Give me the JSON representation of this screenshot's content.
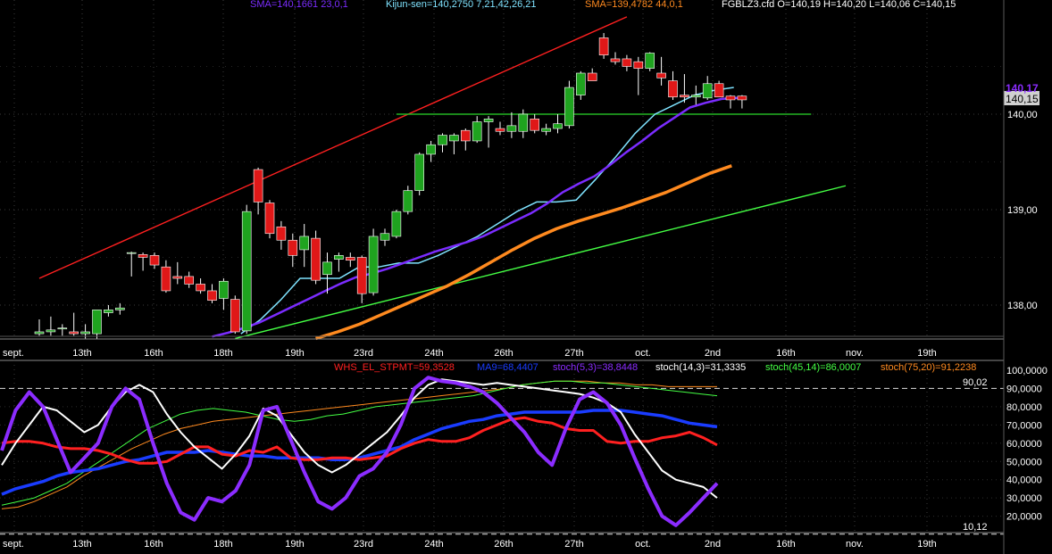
{
  "price_panel": {
    "legend": [
      {
        "text": "SMA=140,1661  23,0,1",
        "color": "#7b2cff"
      },
      {
        "text": "Kijun-sen=140,2750  7,21,42,26,21",
        "color": "#7fe3ff"
      },
      {
        "text": "SMA=139,4782  44,0,1",
        "color": "#ff8a1f"
      },
      {
        "text": "FGBLZ3.cfd O=140,19 H=140,20 L=140,06 C=140,15",
        "color": "#ffffff"
      }
    ],
    "last_price_label": "140,15",
    "high_price_label": "140,17",
    "y_ticks": [
      "140,00",
      "139,00",
      "138,00"
    ]
  },
  "oscillator_panel": {
    "legend": [
      {
        "text": "WHS_EL_STPMT=59,3528",
        "color": "#ff2020"
      },
      {
        "text": "MA9=68,4407",
        "color": "#1a3cff"
      },
      {
        "text": "stoch(5,3)=38,8448",
        "color": "#8b2cff"
      },
      {
        "text": "stoch(14,3)=31,3335",
        "color": "#ffffff"
      },
      {
        "text": "stoch(45,14)=86,0007",
        "color": "#44ff44"
      },
      {
        "text": "stoch(75,20)=91,2238",
        "color": "#ff8a1f"
      }
    ],
    "upper_level_label": "90,02",
    "lower_level_label": "10,12",
    "y_ticks": [
      "100,0000",
      "90,0000",
      "80,0000",
      "70,0000",
      "60,0000",
      "50,0000",
      "40,0000",
      "30,0000",
      "20,0000"
    ]
  },
  "x_axis_labels": [
    "sept.",
    "13th",
    "16th",
    "18th",
    "19th",
    "23rd",
    "24th",
    "26th",
    "27th",
    "oct.",
    "2nd",
    "16th",
    "nov.",
    "19th"
  ],
  "chart_data": [
    {
      "type": "candlestick",
      "instrument": "FGBLZ3.cfd",
      "ylim": [
        137.65,
        141.2
      ],
      "candles": [
        {
          "o": 137.7,
          "h": 137.85,
          "l": 137.68,
          "c": 137.72
        },
        {
          "o": 137.72,
          "h": 137.88,
          "l": 137.68,
          "c": 137.74
        },
        {
          "o": 137.75,
          "h": 137.8,
          "l": 137.68,
          "c": 137.76
        },
        {
          "o": 137.72,
          "h": 137.92,
          "l": 137.68,
          "c": 137.7
        },
        {
          "o": 137.7,
          "h": 137.8,
          "l": 137.65,
          "c": 137.72
        },
        {
          "o": 137.7,
          "h": 137.9,
          "l": 137.65,
          "c": 137.95
        },
        {
          "o": 137.92,
          "h": 138.0,
          "l": 137.88,
          "c": 137.95
        },
        {
          "o": 137.95,
          "h": 138.02,
          "l": 137.9,
          "c": 137.97
        },
        {
          "o": 138.54,
          "h": 138.56,
          "l": 138.3,
          "c": 138.55
        },
        {
          "o": 138.53,
          "h": 138.55,
          "l": 138.36,
          "c": 138.5
        },
        {
          "o": 138.52,
          "h": 138.55,
          "l": 138.38,
          "c": 138.42
        },
        {
          "o": 138.4,
          "h": 138.47,
          "l": 138.13,
          "c": 138.15
        },
        {
          "o": 138.3,
          "h": 138.45,
          "l": 138.22,
          "c": 138.28
        },
        {
          "o": 138.3,
          "h": 138.35,
          "l": 138.18,
          "c": 138.22
        },
        {
          "o": 138.22,
          "h": 138.28,
          "l": 138.12,
          "c": 138.15
        },
        {
          "o": 138.15,
          "h": 138.22,
          "l": 138.02,
          "c": 138.05
        },
        {
          "o": 138.07,
          "h": 138.28,
          "l": 137.95,
          "c": 138.25
        },
        {
          "o": 138.06,
          "h": 138.1,
          "l": 137.7,
          "c": 137.72
        },
        {
          "o": 137.73,
          "h": 139.05,
          "l": 137.7,
          "c": 138.98
        },
        {
          "o": 139.42,
          "h": 139.44,
          "l": 138.95,
          "c": 139.08
        },
        {
          "o": 139.07,
          "h": 139.1,
          "l": 138.7,
          "c": 138.75
        },
        {
          "o": 138.82,
          "h": 138.88,
          "l": 138.58,
          "c": 138.68
        },
        {
          "o": 138.68,
          "h": 138.75,
          "l": 138.4,
          "c": 138.52
        },
        {
          "o": 138.58,
          "h": 138.85,
          "l": 138.4,
          "c": 138.72
        },
        {
          "o": 138.7,
          "h": 138.78,
          "l": 138.22,
          "c": 138.26
        },
        {
          "o": 138.32,
          "h": 138.55,
          "l": 138.12,
          "c": 138.45
        },
        {
          "o": 138.48,
          "h": 138.55,
          "l": 138.35,
          "c": 138.52
        },
        {
          "o": 138.5,
          "h": 138.55,
          "l": 138.4,
          "c": 138.47
        },
        {
          "o": 138.5,
          "h": 138.52,
          "l": 138.02,
          "c": 138.12
        },
        {
          "o": 138.13,
          "h": 138.8,
          "l": 138.1,
          "c": 138.72
        },
        {
          "o": 138.68,
          "h": 138.8,
          "l": 138.62,
          "c": 138.75
        },
        {
          "o": 138.72,
          "h": 139.0,
          "l": 138.7,
          "c": 138.98
        },
        {
          "o": 138.98,
          "h": 139.25,
          "l": 138.95,
          "c": 139.2
        },
        {
          "o": 139.2,
          "h": 139.6,
          "l": 139.15,
          "c": 139.58
        },
        {
          "o": 139.58,
          "h": 139.72,
          "l": 139.5,
          "c": 139.68
        },
        {
          "o": 139.68,
          "h": 139.8,
          "l": 139.6,
          "c": 139.78
        },
        {
          "o": 139.72,
          "h": 139.8,
          "l": 139.58,
          "c": 139.78
        },
        {
          "o": 139.83,
          "h": 139.85,
          "l": 139.62,
          "c": 139.72
        },
        {
          "o": 139.72,
          "h": 139.98,
          "l": 139.7,
          "c": 139.92
        },
        {
          "o": 139.92,
          "h": 139.98,
          "l": 139.65,
          "c": 139.95
        },
        {
          "o": 139.85,
          "h": 139.92,
          "l": 139.78,
          "c": 139.82
        },
        {
          "o": 139.82,
          "h": 140.02,
          "l": 139.75,
          "c": 139.88
        },
        {
          "o": 139.82,
          "h": 140.05,
          "l": 139.75,
          "c": 140.0
        },
        {
          "o": 139.95,
          "h": 140.0,
          "l": 139.8,
          "c": 139.83
        },
        {
          "o": 139.82,
          "h": 139.9,
          "l": 139.78,
          "c": 139.85
        },
        {
          "o": 139.85,
          "h": 140.0,
          "l": 139.8,
          "c": 139.9
        },
        {
          "o": 139.88,
          "h": 140.35,
          "l": 139.85,
          "c": 140.28
        },
        {
          "o": 140.2,
          "h": 140.45,
          "l": 140.15,
          "c": 140.43
        },
        {
          "o": 140.43,
          "h": 140.48,
          "l": 140.38,
          "c": 140.35
        },
        {
          "o": 140.8,
          "h": 140.85,
          "l": 140.58,
          "c": 140.62
        },
        {
          "o": 140.58,
          "h": 140.65,
          "l": 140.52,
          "c": 140.55
        },
        {
          "o": 140.58,
          "h": 140.62,
          "l": 140.45,
          "c": 140.5
        },
        {
          "o": 140.55,
          "h": 140.6,
          "l": 140.2,
          "c": 140.48
        },
        {
          "o": 140.48,
          "h": 140.65,
          "l": 140.45,
          "c": 140.64
        },
        {
          "o": 140.43,
          "h": 140.6,
          "l": 140.3,
          "c": 140.38
        },
        {
          "o": 140.35,
          "h": 140.45,
          "l": 140.15,
          "c": 140.18
        },
        {
          "o": 140.2,
          "h": 140.42,
          "l": 140.12,
          "c": 140.18
        },
        {
          "o": 140.18,
          "h": 140.3,
          "l": 140.1,
          "c": 140.2
        },
        {
          "o": 140.17,
          "h": 140.4,
          "l": 140.15,
          "c": 140.32
        },
        {
          "o": 140.32,
          "h": 140.35,
          "l": 140.18,
          "c": 140.18
        },
        {
          "o": 140.19,
          "h": 140.2,
          "l": 140.06,
          "c": 140.15
        },
        {
          "o": 140.19,
          "h": 140.2,
          "l": 140.06,
          "c": 140.15
        }
      ],
      "sma_23": [
        137.67,
        137.71,
        137.76,
        137.82,
        137.9,
        137.98,
        138.06,
        138.14,
        138.22,
        138.29,
        138.33,
        138.38,
        138.44,
        138.5,
        138.56,
        138.61,
        138.66,
        138.72,
        138.8,
        138.88,
        138.96,
        139.06,
        139.18,
        139.27,
        139.35,
        139.47,
        139.6,
        139.72,
        139.85,
        139.96,
        140.07,
        140.12,
        140.16,
        140.17
      ],
      "kijun_sen": [
        137.7,
        137.85,
        138.05,
        138.28,
        138.28,
        138.28,
        138.4,
        138.4,
        138.44,
        138.44,
        138.52,
        138.62,
        138.72,
        138.85,
        138.98,
        139.08,
        139.08,
        139.1,
        139.32,
        139.55,
        139.8,
        140.0,
        140.1,
        140.2,
        140.25,
        140.28
      ],
      "sma_44": [
        137.65,
        137.72,
        137.8,
        137.9,
        138.0,
        138.1,
        138.2,
        138.32,
        138.45,
        138.58,
        138.7,
        138.8,
        138.88,
        138.95,
        139.02,
        139.1,
        139.18,
        139.28,
        139.38,
        139.46
      ],
      "reference_lines": [
        {
          "name": "upper channel",
          "from": [
            0,
            138.28
          ],
          "to": [
            51,
            141.02
          ],
          "color": "#ff2020"
        },
        {
          "name": "horizontal level",
          "from": [
            31,
            140.0
          ],
          "to": [
            67,
            140.0
          ],
          "color": "#22b522"
        },
        {
          "name": "lower trendline",
          "from": [
            17,
            137.65
          ],
          "to": [
            70,
            139.25
          ],
          "color": "#44ff44"
        }
      ]
    },
    {
      "type": "line",
      "ylim": [
        10,
        102
      ],
      "levels": [
        90.02,
        10.12
      ],
      "series": [
        {
          "name": "WHS_EL_STPMT",
          "values": [
            60,
            61,
            61,
            60,
            58,
            57,
            57,
            56,
            54,
            51,
            49,
            49,
            50,
            54,
            58,
            58,
            54,
            53,
            56,
            55,
            58,
            52,
            51,
            51,
            52,
            52,
            51,
            52,
            53,
            57,
            60,
            62,
            61,
            61,
            63,
            67,
            70,
            73,
            74,
            72,
            71,
            68,
            67,
            67,
            61,
            60,
            61,
            61,
            63,
            64,
            66,
            63,
            59
          ]
        },
        {
          "name": "MA9",
          "values": [
            32,
            35,
            37,
            39,
            42,
            44,
            45,
            46,
            48,
            50,
            51,
            53,
            55,
            55,
            55,
            56,
            55,
            54,
            53,
            53,
            52,
            52,
            52,
            52,
            51,
            51,
            52,
            54,
            56,
            58,
            62,
            65,
            68,
            70,
            72,
            73,
            75,
            76,
            77,
            77,
            77,
            77,
            77,
            78,
            78,
            78,
            77,
            76,
            75,
            73,
            71,
            70,
            69
          ]
        },
        {
          "name": "stoch(5,3)",
          "values": [
            56,
            78,
            88,
            80,
            62,
            44,
            52,
            60,
            80,
            90,
            84,
            60,
            38,
            22,
            18,
            30,
            28,
            34,
            48,
            78,
            80,
            62,
            44,
            28,
            24,
            30,
            42,
            46,
            55,
            70,
            90,
            96,
            94,
            93,
            91,
            88,
            82,
            74,
            66,
            55,
            48,
            68,
            84,
            88,
            82,
            70,
            52,
            35,
            20,
            15,
            22,
            30,
            38
          ]
        },
        {
          "name": "stoch(14,3)",
          "values": [
            48,
            60,
            70,
            80,
            78,
            72,
            66,
            70,
            80,
            88,
            92,
            88,
            76,
            66,
            58,
            52,
            46,
            54,
            64,
            79,
            75,
            65,
            55,
            48,
            44,
            48,
            54,
            60,
            66,
            75,
            85,
            92,
            95,
            94,
            93,
            92,
            93,
            92,
            91,
            90,
            89,
            88,
            87,
            85,
            82,
            77,
            65,
            55,
            45,
            40,
            38,
            36,
            30
          ]
        },
        {
          "name": "stoch(45,14)",
          "values": [
            26,
            28,
            30,
            34,
            38,
            44,
            50,
            56,
            62,
            68,
            72,
            76,
            78,
            79,
            78,
            77,
            75,
            73,
            72,
            73,
            75,
            76,
            78,
            80,
            81,
            82,
            83,
            84,
            85,
            86,
            88,
            90,
            92,
            93,
            94,
            94,
            93,
            93,
            92,
            91,
            90,
            89,
            88,
            87,
            86
          ]
        },
        {
          "name": "stoch(75,20)",
          "values": [
            24,
            25,
            28,
            32,
            36,
            42,
            47,
            52,
            57,
            61,
            65,
            68,
            70,
            72,
            73,
            74,
            75,
            76,
            77,
            78,
            79,
            80,
            81,
            82,
            83,
            84,
            85,
            86,
            87,
            88,
            89,
            90,
            92,
            93,
            94,
            94,
            94,
            93,
            93,
            92,
            92,
            91,
            91,
            91,
            91
          ]
        }
      ]
    }
  ]
}
